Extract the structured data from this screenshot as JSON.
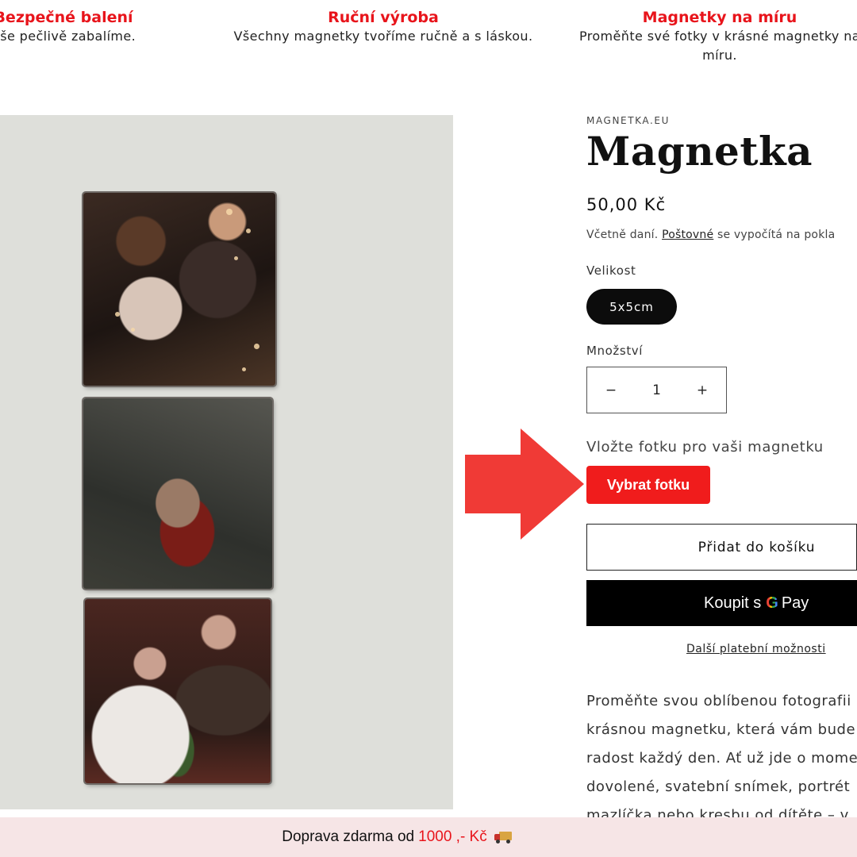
{
  "features": [
    {
      "title": "Bezpečné balení",
      "text": "Vše pečlivě zabalíme."
    },
    {
      "title": "Ruční výroba",
      "text": "Všechny magnetky tvoříme ručně a s láskou."
    },
    {
      "title": "Magnetky na míru",
      "text": "Proměňte své fotky v krásné magnetky na míru."
    }
  ],
  "product": {
    "vendor": "MAGNETKA.EU",
    "title": "Magnetka",
    "price": "50,00 Kč",
    "tax_prefix": "Včetně daní.",
    "tax_link": "Poštovné",
    "tax_suffix": "se vypočítá na pokla",
    "size_label": "Velikost",
    "size_option": "5x5cm",
    "qty_label": "Množství",
    "qty_minus": "−",
    "qty_value": "1",
    "qty_plus": "+",
    "upload_label": "Vložte fotku pro vaši magnetku",
    "upload_button": "Vybrat fotku",
    "add_to_cart": "Přidat do košíku",
    "gpay_prefix": "Koupit s",
    "gpay_g": "G",
    "gpay_pay": "Pay",
    "more_payment": "Další platební možnosti",
    "description_lines": [
      "Proměňte svou oblíbenou fotografii",
      "krásnou magnetku, která vám bude",
      "radost každý den. Ať už jde o mome",
      "dovolené, svatební snímek, portrét",
      "mazlíčka nebo kresbu od dítěte – v"
    ]
  },
  "banner": {
    "prefix": "Doprava zdarma od",
    "amount": "1000 ,- Kč",
    "icon": "truck-icon"
  },
  "colors": {
    "accent_red": "#e8141b",
    "button_red": "#f01c1c",
    "arrow_red": "#f03a36",
    "banner_bg": "#f6e5e6"
  }
}
